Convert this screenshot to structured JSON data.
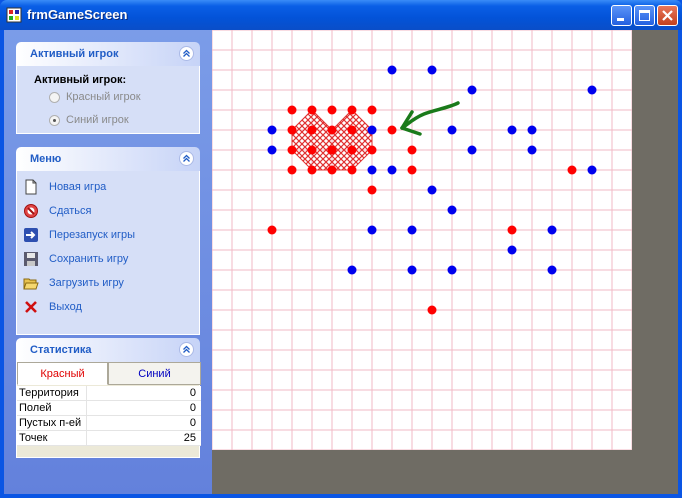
{
  "window": {
    "title": "frmGameScreen"
  },
  "active_player_panel": {
    "header": "Активный игрок",
    "label": "Активный игрок:",
    "options": [
      {
        "label": "Красный игрок",
        "selected": false
      },
      {
        "label": "Синий игрок",
        "selected": true
      }
    ]
  },
  "menu_panel": {
    "header": "Меню",
    "items": [
      {
        "label": "Новая игра",
        "icon": "new-document-icon"
      },
      {
        "label": "Сдаться",
        "icon": "surrender-icon"
      },
      {
        "label": "Перезапуск игры",
        "icon": "restart-arrow-icon"
      },
      {
        "label": "Сохранить игру",
        "icon": "save-disk-icon"
      },
      {
        "label": "Загрузить игру",
        "icon": "open-folder-icon"
      },
      {
        "label": "Выход",
        "icon": "exit-x-icon"
      }
    ]
  },
  "stats_panel": {
    "header": "Статистика",
    "tabs": [
      {
        "label": "Красный",
        "active": true
      },
      {
        "label": "Синий",
        "active": false
      }
    ],
    "rows": [
      {
        "key": "Территория",
        "value": "0"
      },
      {
        "key": "Полей",
        "value": "0"
      },
      {
        "key": "Пустых п-ей",
        "value": "0"
      },
      {
        "key": "Точек",
        "value": "25"
      }
    ]
  },
  "board": {
    "grid_color": "#f2b8c6",
    "red_color": "#ff0000",
    "blue_color": "#0000ee",
    "captured_fill": "#e03030",
    "arrow_color": "#1a7a1a",
    "cols": 21,
    "rows": 21,
    "red_dots": [
      [
        4,
        4
      ],
      [
        5,
        4
      ],
      [
        6,
        4
      ],
      [
        7,
        4
      ],
      [
        8,
        4
      ],
      [
        4,
        5
      ],
      [
        5,
        5
      ],
      [
        6,
        5
      ],
      [
        7,
        5
      ],
      [
        9,
        5
      ],
      [
        4,
        6
      ],
      [
        5,
        6
      ],
      [
        6,
        6
      ],
      [
        7,
        6
      ],
      [
        8,
        6
      ],
      [
        10,
        6
      ],
      [
        4,
        7
      ],
      [
        5,
        7
      ],
      [
        6,
        7
      ],
      [
        7,
        7
      ],
      [
        10,
        7
      ],
      [
        8,
        8
      ],
      [
        3,
        10
      ],
      [
        15,
        10
      ],
      [
        11,
        14
      ],
      [
        18,
        7
      ]
    ],
    "blue_dots": [
      [
        9,
        2
      ],
      [
        11,
        2
      ],
      [
        13,
        3
      ],
      [
        19,
        3
      ],
      [
        3,
        5
      ],
      [
        8,
        5
      ],
      [
        12,
        5
      ],
      [
        15,
        5
      ],
      [
        16,
        5
      ],
      [
        3,
        6
      ],
      [
        13,
        6
      ],
      [
        16,
        6
      ],
      [
        8,
        7
      ],
      [
        9,
        7
      ],
      [
        19,
        7
      ],
      [
        11,
        8
      ],
      [
        12,
        9
      ],
      [
        8,
        10
      ],
      [
        10,
        10
      ],
      [
        17,
        10
      ],
      [
        15,
        11
      ],
      [
        7,
        12
      ],
      [
        10,
        12
      ],
      [
        12,
        12
      ],
      [
        17,
        12
      ]
    ]
  }
}
